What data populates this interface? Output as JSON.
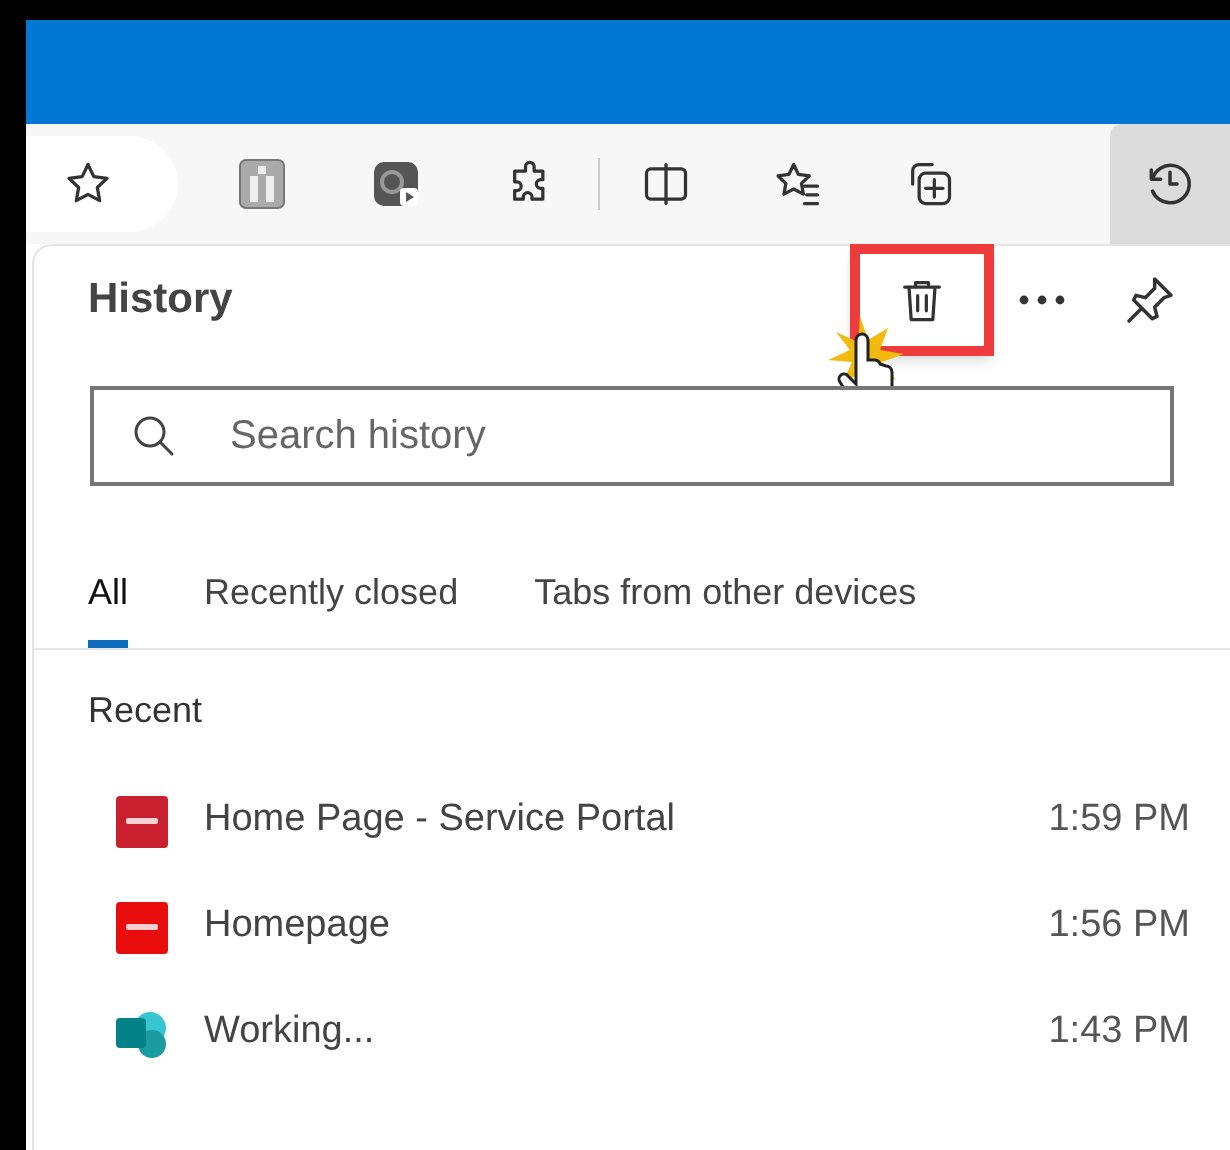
{
  "panel": {
    "title": "History"
  },
  "search": {
    "placeholder": "Search history"
  },
  "tabs": [
    {
      "label": "All",
      "selected": true
    },
    {
      "label": "Recently closed",
      "selected": false
    },
    {
      "label": "Tabs from other devices",
      "selected": false
    }
  ],
  "section": "Recent",
  "items": [
    {
      "title": "Home Page - Service Portal",
      "time": "1:59 PM",
      "kind": "tile",
      "color": "#c8202f"
    },
    {
      "title": "Homepage",
      "time": "1:56 PM",
      "kind": "tile",
      "color": "#e80c0c"
    },
    {
      "title": "Working...",
      "time": "1:43 PM",
      "kind": "round",
      "color": "#038387"
    }
  ]
}
